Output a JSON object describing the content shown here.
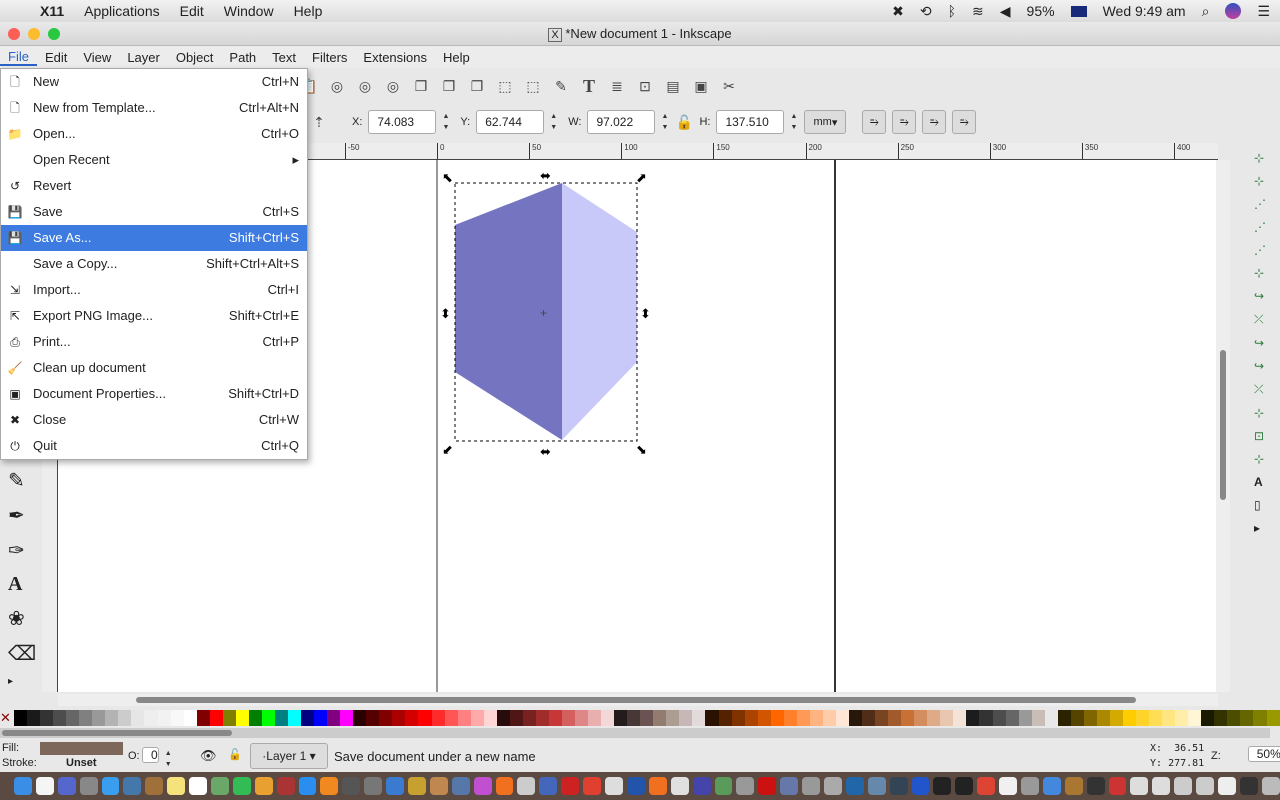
{
  "mac_menubar": {
    "app": "X11",
    "items": [
      "Applications",
      "Edit",
      "Window",
      "Help"
    ],
    "battery": "95%",
    "clock": "Wed 9:49 am"
  },
  "window": {
    "title": "*New document 1 - Inkscape"
  },
  "menubar": [
    "File",
    "Edit",
    "View",
    "Layer",
    "Object",
    "Path",
    "Text",
    "Filters",
    "Extensions",
    "Help"
  ],
  "file_menu": [
    {
      "label": "New",
      "shortcut": "Ctrl+N",
      "icon": "new-document-icon"
    },
    {
      "label": "New from Template...",
      "shortcut": "Ctrl+Alt+N",
      "icon": "template-icon"
    },
    {
      "label": "Open...",
      "shortcut": "Ctrl+O",
      "icon": "folder-icon"
    },
    {
      "label": "Open Recent",
      "shortcut": "▸",
      "icon": ""
    },
    {
      "label": "Revert",
      "shortcut": "",
      "icon": "revert-icon"
    },
    {
      "label": "Save",
      "shortcut": "Ctrl+S",
      "icon": "save-icon"
    },
    {
      "label": "Save As...",
      "shortcut": "Shift+Ctrl+S",
      "icon": "save-as-icon",
      "selected": true
    },
    {
      "label": "Save a Copy...",
      "shortcut": "Shift+Ctrl+Alt+S",
      "icon": ""
    },
    {
      "label": "Import...",
      "shortcut": "Ctrl+I",
      "icon": "import-icon"
    },
    {
      "label": "Export PNG Image...",
      "shortcut": "Shift+Ctrl+E",
      "icon": "export-icon"
    },
    {
      "label": "Print...",
      "shortcut": "Ctrl+P",
      "icon": "print-icon"
    },
    {
      "label": "Clean up document",
      "shortcut": "",
      "icon": "cleanup-icon"
    },
    {
      "label": "Document Properties...",
      "shortcut": "Shift+Ctrl+D",
      "icon": "properties-icon"
    },
    {
      "label": "Close",
      "shortcut": "Ctrl+W",
      "icon": "close-icon"
    },
    {
      "label": "Quit",
      "shortcut": "Ctrl+Q",
      "icon": "quit-icon"
    }
  ],
  "toolbar": {
    "x_label": "X:",
    "x": "74.083",
    "y_label": "Y:",
    "y": "62.744",
    "w_label": "W:",
    "w": "97.022",
    "h_label": "H:",
    "h": "137.510",
    "unit": "mm"
  },
  "ruler": {
    "labels": [
      "-50",
      "0",
      "50",
      "100",
      "150",
      "200",
      "250",
      "300",
      "350",
      "400"
    ]
  },
  "shape": {
    "left_color": "#7474c0",
    "right_color": "#c9c9f9"
  },
  "palette": [
    "#000000",
    "#1a1a1a",
    "#333333",
    "#4d4d4d",
    "#666666",
    "#808080",
    "#999999",
    "#b3b3b3",
    "#cccccc",
    "#e6e6e6",
    "#eeeeee",
    "#f2f2f2",
    "#f8f8f8",
    "#ffffff",
    "#800000",
    "#ff0000",
    "#808000",
    "#ffff00",
    "#008000",
    "#00ff00",
    "#008080",
    "#00ffff",
    "#000080",
    "#0000ff",
    "#800080",
    "#ff00ff",
    "#2b0000",
    "#550000",
    "#800000",
    "#aa0000",
    "#d40000",
    "#ff0000",
    "#ff2a2a",
    "#ff5555",
    "#ff8080",
    "#ffaaaa",
    "#ffd5d5",
    "#280b0b",
    "#501616",
    "#782121",
    "#a02c2c",
    "#c83737",
    "#d35f5f",
    "#de8787",
    "#e9afaf",
    "#f4d7d7",
    "#241c1c",
    "#483737",
    "#6c5353",
    "#917c6f",
    "#ac9d93",
    "#c8b7b7",
    "#e3dbdb",
    "#2b1100",
    "#552200",
    "#803300",
    "#aa4400",
    "#d45500",
    "#ff6600",
    "#ff7f2a",
    "#ff9955",
    "#ffb380",
    "#ffccaa",
    "#ffe6d5",
    "#28170b",
    "#502d16",
    "#784421",
    "#a05a2c",
    "#c87137",
    "#d38d5f",
    "#deaa87",
    "#e9c6af",
    "#f4e3d7",
    "#1c1c1c",
    "#333333",
    "#4d4d4d",
    "#666666",
    "#999999",
    "#c8beb7",
    "#e8e8e8",
    "#2b2200",
    "#554400",
    "#806600",
    "#aa8800",
    "#d4aa00",
    "#ffcc00",
    "#ffd42a",
    "#ffdd55",
    "#ffe680",
    "#ffeeaa",
    "#fff6d5",
    "#1a1a00",
    "#333300",
    "#4d4d00",
    "#666600",
    "#808000",
    "#999900"
  ],
  "status": {
    "fill_label": "Fill:",
    "stroke_label": "Stroke:",
    "stroke_value": "Unset",
    "fill_color": "#7d675a",
    "opacity_label": "O:",
    "opacity": "0",
    "layer": "·Layer 1",
    "message": "Save document under a new name",
    "cx_label": "X:",
    "cx": "36.51",
    "cy_label": "Y:",
    "cy": "277.81",
    "zoom_label": "Z:",
    "zoom": "50%"
  },
  "dock": [
    "#3a8ee6",
    "#f5f5f5",
    "#5566cc",
    "#888888",
    "#3a9ef0",
    "#4477aa",
    "#a0703a",
    "#f6e27a",
    "#ffffff",
    "#6aa86a",
    "#33bb55",
    "#e8a030",
    "#aa3333",
    "#2a8ef0",
    "#f08a20",
    "#555555",
    "#777777",
    "#3a7ad0",
    "#c8a030",
    "#c08850",
    "#5577aa",
    "#c050d0",
    "#f07020",
    "#cccccc",
    "#4466bb",
    "#cc2222",
    "#e04030",
    "#dddddd",
    "#2255aa",
    "#f07020",
    "#e0e0e0",
    "#4444aa",
    "#5a9a5a",
    "#999999",
    "#cc1111",
    "#6677aa",
    "#999999",
    "#aaaaaa",
    "#2266aa",
    "#6688aa",
    "#334455",
    "#2255cc",
    "#222222",
    "#222222",
    "#dd4433",
    "#f0f0f0",
    "#999999",
    "#4488dd",
    "#aa7733",
    "#333333",
    "#cc3333",
    "#dddddd",
    "#dddddd",
    "#cccccc",
    "#cccccc",
    "#eeeeee",
    "#333333",
    "#bbbbbb"
  ]
}
